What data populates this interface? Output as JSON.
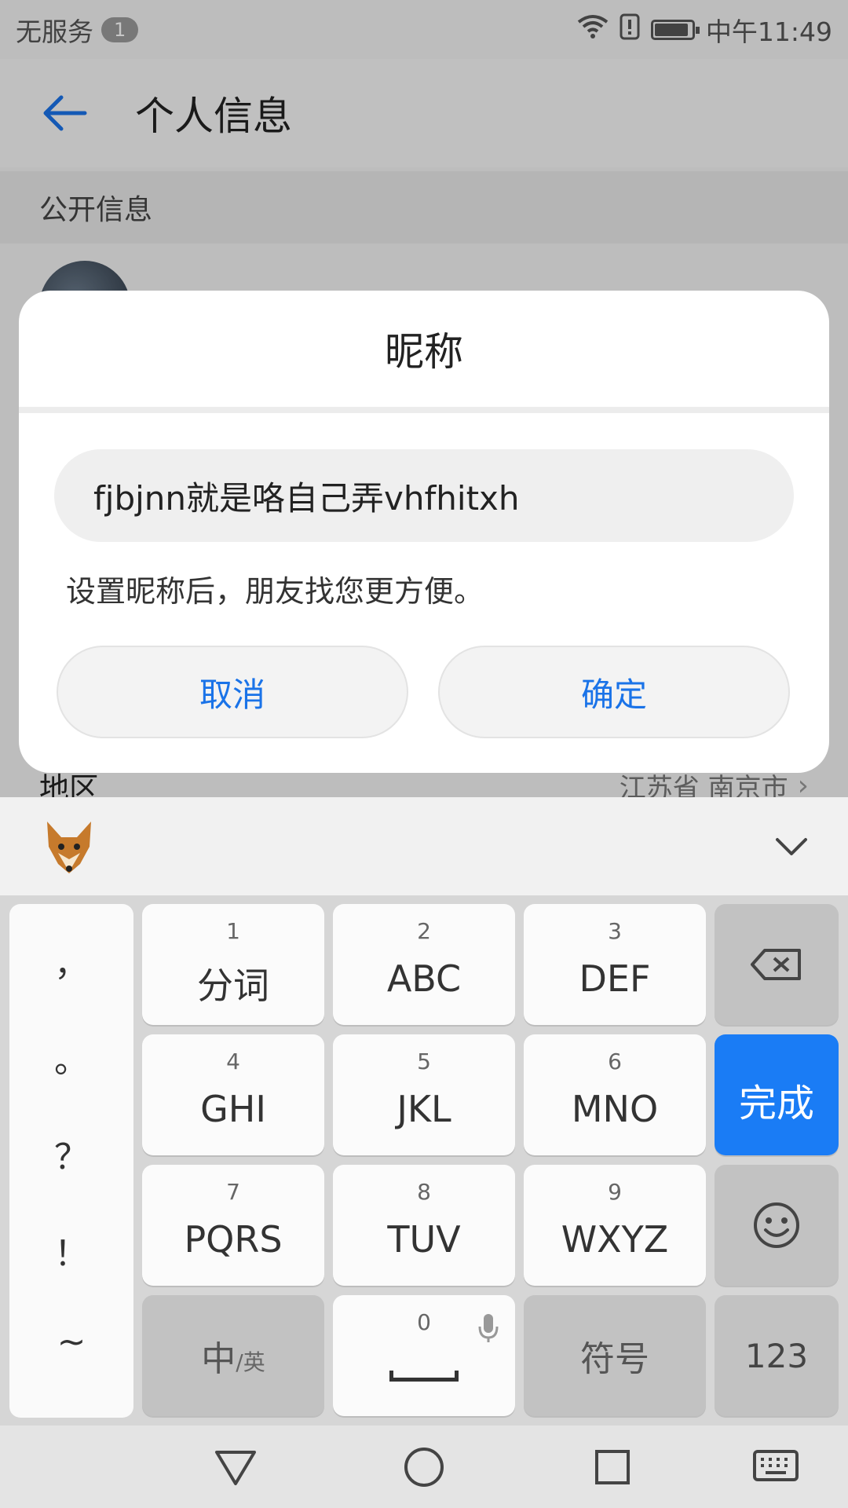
{
  "status_bar": {
    "carrier": "无服务",
    "sim_count": "1",
    "time": "中午11:49",
    "battery_level": 0.85,
    "icons": [
      "wifi-icon",
      "alert-icon",
      "battery-icon"
    ]
  },
  "app_bar": {
    "title": "个人信息",
    "back_icon": "arrow-left-icon"
  },
  "page": {
    "section_header": "公开信息",
    "region_label": "地区",
    "region_value": "江苏省 南京市"
  },
  "dialog": {
    "title": "昵称",
    "input_value": "fjbjnn就是咯自己弄vhfhitxh",
    "hint": "设置昵称后，朋友找您更方便。",
    "cancel_label": "取消",
    "ok_label": "确定"
  },
  "keyboard": {
    "punctuation": [
      "，",
      "。",
      "？",
      "！",
      "~"
    ],
    "keys": [
      {
        "num": "1",
        "label": "分词"
      },
      {
        "num": "2",
        "label": "ABC"
      },
      {
        "num": "3",
        "label": "DEF"
      },
      {
        "num": "4",
        "label": "GHI"
      },
      {
        "num": "5",
        "label": "JKL"
      },
      {
        "num": "6",
        "label": "MNO"
      },
      {
        "num": "7",
        "label": "PQRS"
      },
      {
        "num": "8",
        "label": "TUV"
      },
      {
        "num": "9",
        "label": "WXYZ"
      }
    ],
    "done_label": "完成",
    "lang_main": "中",
    "lang_sub": "/英",
    "space_num": "0",
    "symbols_label": "符号",
    "numbers_label": "123",
    "accent_color": "#1a7cf5"
  },
  "navigation": [
    "back-triangle-icon",
    "home-circle-icon",
    "recents-square-icon",
    "keyboard-icon"
  ]
}
